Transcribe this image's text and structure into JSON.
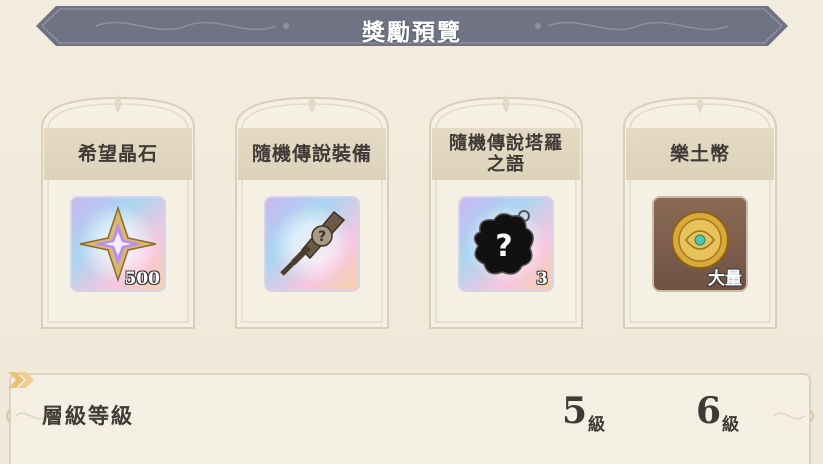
{
  "header": {
    "title": "獎勵預覽"
  },
  "rewards": [
    {
      "name": "希望晶石",
      "quantity": "500",
      "icon": "hope-crystal-icon"
    },
    {
      "name": "隨機傳說裝備",
      "quantity": "",
      "icon": "random-legendary-weapon-icon"
    },
    {
      "name": "隨機傳說塔羅\n之語",
      "quantity": "3",
      "icon": "random-tarot-charm-icon"
    },
    {
      "name": "樂土幣",
      "quantity": "大量",
      "icon": "paradise-coin-icon"
    }
  ],
  "level": {
    "label": "層級等級",
    "from": "5",
    "to": "6",
    "unit": "級",
    "arrow_icon": "double-chevron-right-icon"
  },
  "colors": {
    "banner": "#6f7383",
    "background": "#f1ebdd",
    "card_label_bg": "#e2d7c0",
    "arrow": "#e9c27a",
    "text": "#3e3a36"
  }
}
